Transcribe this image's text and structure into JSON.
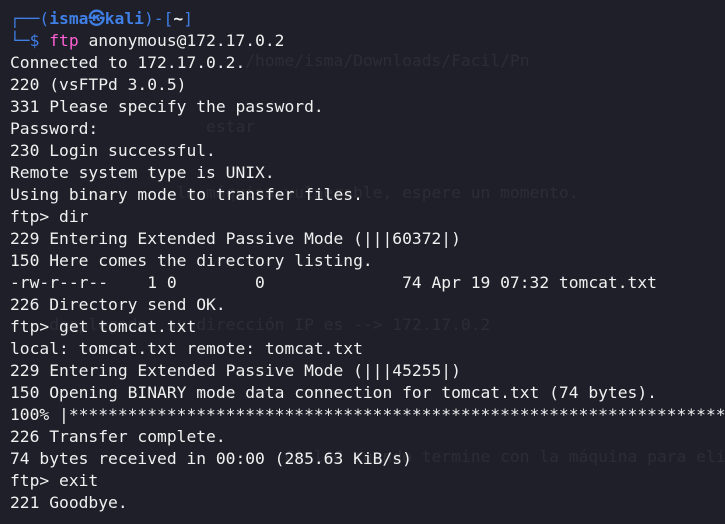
{
  "prompt": {
    "open": "┌──(",
    "user": "isma",
    "at": "㉿",
    "host": "kali",
    "mid": ")-[",
    "path": "~",
    "close": "]",
    "second_open": "└─",
    "dollar": "$ ",
    "command": "ftp",
    "argument": " anonymous@172.17.0.2"
  },
  "ghost_lines": [
    "                        /home/isma/Downloads/Facil/Pn",
    "                    estar",
    "                 la máquina vulnerable, espere un momento.",
    "",
    "    desplegada, su dirección IP es --> 172.17.0.2",
    "",
    "                            Ctrl+C cuando termine con la máquina para eliminarla"
  ],
  "output_lines": [
    "Connected to 172.17.0.2.",
    "220 (vsFTPd 3.0.5)",
    "331 Please specify the password.",
    "Password:",
    "230 Login successful.",
    "Remote system type is UNIX.",
    "Using binary mode to transfer files.",
    "ftp> dir",
    "229 Entering Extended Passive Mode (|||60372|)",
    "150 Here comes the directory listing.",
    "-rw-r--r--    1 0        0              74 Apr 19 07:32 tomcat.txt",
    "226 Directory send OK.",
    "ftp> get tomcat.txt",
    "local: tomcat.txt remote: tomcat.txt",
    "229 Entering Extended Passive Mode (|||45255|)",
    "150 Opening BINARY mode data connection for tomcat.txt (74 bytes).",
    "100% |************************************************************************",
    "226 Transfer complete.",
    "74 bytes received in 00:00 (285.63 KiB/s)",
    "ftp> exit",
    "221 Goodbye."
  ],
  "colors": {
    "background": "#1e1f29",
    "prompt_blue": "#3f7fe6",
    "command_pink": "#ff5fd3",
    "text": "#f0f0f0"
  }
}
